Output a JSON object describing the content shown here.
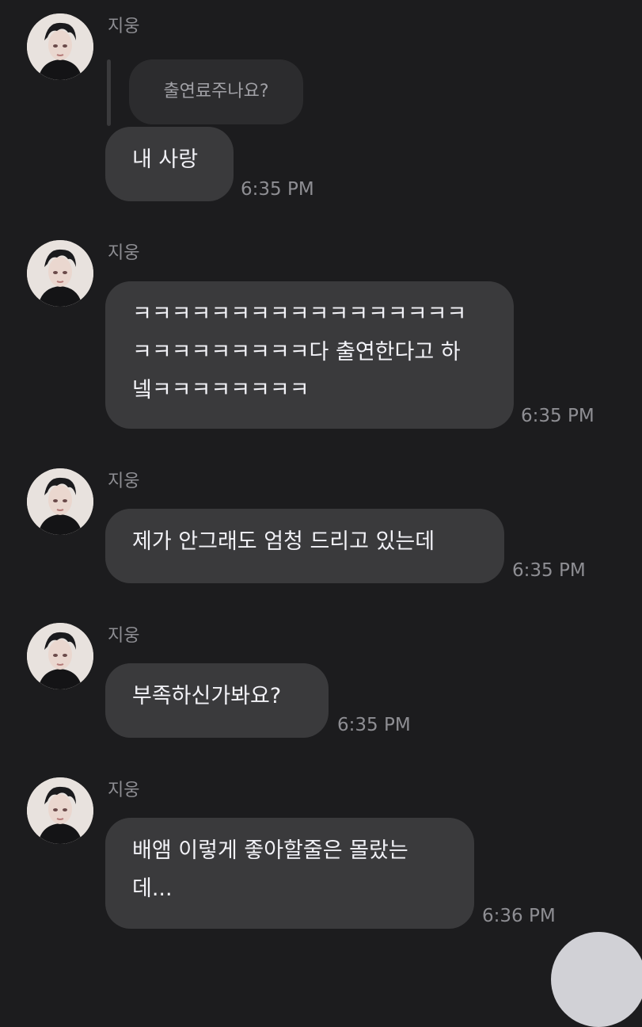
{
  "messages": [
    {
      "sender": "지웅",
      "reply_quote": "출연료주나요?",
      "text": "내 사랑",
      "time": "6:35 PM"
    },
    {
      "sender": "지웅",
      "text": "ㅋㅋㅋㅋㅋㅋㅋㅋㅋㅋㅋㅋㅋㅋㅋㅋㅋ\nㅋㅋㅋㅋㅋㅋㅋㅋㅋ다 출연한다고 하\n넼ㅋㅋㅋㅋㅋㅋㅋㅋ",
      "time": "6:35 PM"
    },
    {
      "sender": "지웅",
      "text": "제가 안그래도 엄청 드리고 있는데",
      "time": "6:35 PM"
    },
    {
      "sender": "지웅",
      "text": "부족하신가봐요?",
      "time": "6:35 PM"
    },
    {
      "sender": "지웅",
      "text": "배앰 이렇게 좋아할줄은 몰랐는\n데...",
      "time": "6:36 PM"
    }
  ]
}
